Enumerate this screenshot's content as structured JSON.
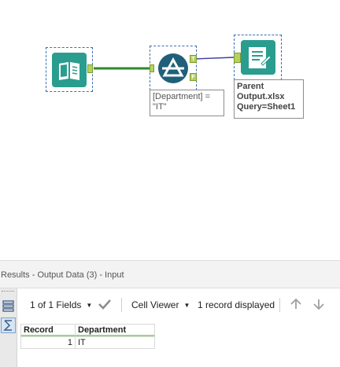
{
  "workflow": {
    "filter_expression": "[Department] = \n\"IT\"",
    "filter_true_anchor": "T",
    "filter_false_anchor": "F",
    "output_annotation": "Parent\nOutput.xlsx\nQuery=Sheet1"
  },
  "colors": {
    "wire_main": "#2c8a2c",
    "wire_true": "#3c3ca6",
    "anchor": "#b5d25d",
    "tool_teal": "#2a9d8f",
    "tool_navy": "#1f5f7a",
    "selection": "#3a6fb0"
  },
  "results": {
    "header_title": "Results - Output Data (3) - Input",
    "fields_label": "1 of 1 Fields",
    "viewer_label": "Cell Viewer",
    "records_label": "1 record displayed",
    "side_icons": [
      "list-icon",
      "metadata-icon"
    ],
    "columns": [
      "Record",
      "Department"
    ],
    "rows": [
      {
        "record": "1",
        "department": "IT"
      }
    ]
  }
}
